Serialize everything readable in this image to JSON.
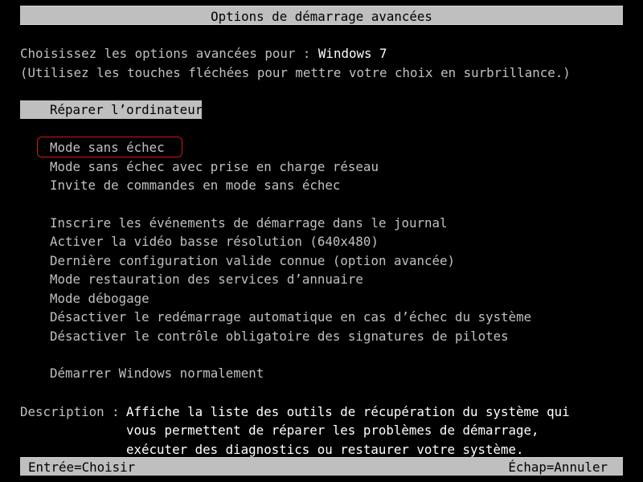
{
  "title": "Options de démarrage avancées",
  "intro": {
    "prompt_prefix": "Choisissez les options avancées pour : ",
    "os_name": "Windows 7",
    "hint": "(Utilisez les touches fléchées pour mettre votre choix en surbrillance.)"
  },
  "selected_option": "Réparer l’ordinateur",
  "annotated_option": "Mode sans échec",
  "annotation_color": "#d01818",
  "options_group1": [
    "Mode sans échec",
    "Mode sans échec avec prise en charge réseau",
    "Invite de commandes en mode sans échec"
  ],
  "options_group2": [
    "Inscrire les événements de démarrage dans le journal",
    "Activer la vidéo basse résolution (640x480)",
    "Dernière configuration valide connue (option avancée)",
    "Mode restauration des services d’annuaire",
    "Mode débogage",
    "Désactiver le redémarrage automatique en cas d’échec du système",
    "Désactiver le contrôle obligatoire des signatures de pilotes"
  ],
  "options_group3": [
    "Démarrer Windows normalement"
  ],
  "description": {
    "label": "Description : ",
    "lines": [
      "Affiche la liste des outils de récupération du système qui",
      "vous permettent de réparer les problèmes de démarrage,",
      "exécuter des diagnostics ou restaurer votre système."
    ]
  },
  "footer": {
    "left": "Entrée=Choisir",
    "right": "Échap=Annuler"
  }
}
